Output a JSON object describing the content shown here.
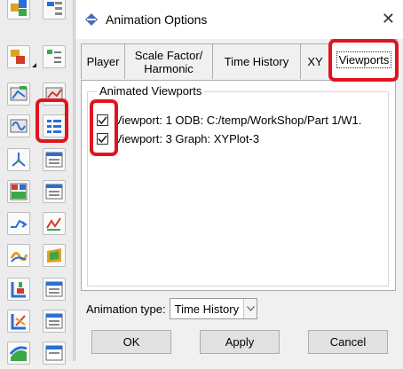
{
  "dialog": {
    "title": "Animation Options",
    "tabs": [
      {
        "label": "Player"
      },
      {
        "label": "Scale Factor/ Harmonic"
      },
      {
        "label": "Time History"
      },
      {
        "label": "XY"
      },
      {
        "label": "Viewports",
        "active": true
      }
    ],
    "group_title": "Animated Viewports",
    "viewports": [
      {
        "checked": true,
        "label": "Viewport: 1  ODB: C:/temp/WorkShop/Part 1/W1."
      },
      {
        "checked": true,
        "label": "Viewport: 3  Graph: XYPlot-3"
      }
    ],
    "animation_type_label": "Animation type:",
    "animation_type_value": "Time History",
    "buttons": {
      "ok": "OK",
      "apply": "Apply",
      "cancel": "Cancel"
    }
  },
  "colors": {
    "highlight": "#e0141e",
    "dialog_bg": "#f0f0f0",
    "pane_bg": "#ffffff"
  }
}
